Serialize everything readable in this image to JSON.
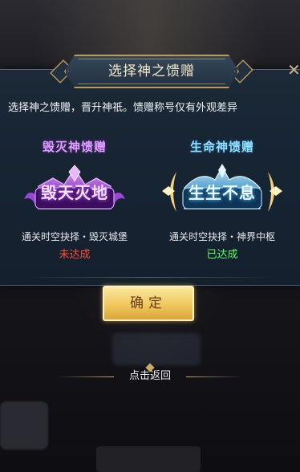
{
  "dialog": {
    "title": "选择神之馈赠",
    "description": "选择神之馈赠，晋升神祇。馈赠称号仅有外观差异",
    "close_symbol": "✕"
  },
  "gifts": [
    {
      "name": "毁灭神馈赠",
      "emblem_text": "毁天灭地",
      "condition": "通关时空抉择・毁灭城堡",
      "status": "未达成",
      "status_color": "#ff4b3b",
      "emblem_icon": "purple-crown-emblem-icon"
    },
    {
      "name": "生命神馈赠",
      "emblem_text": "生生不息",
      "condition": "通关时空抉择・神界中枢",
      "status": "已达成",
      "status_color": "#59ff6a",
      "emblem_icon": "blue-winged-emblem-icon"
    }
  ],
  "confirm_label": "确定",
  "back_label": "点击返回",
  "colors": {
    "gold_accent": "#b89a5a",
    "dialog_bg": "#172433",
    "button_gold": "#f0c85c"
  }
}
